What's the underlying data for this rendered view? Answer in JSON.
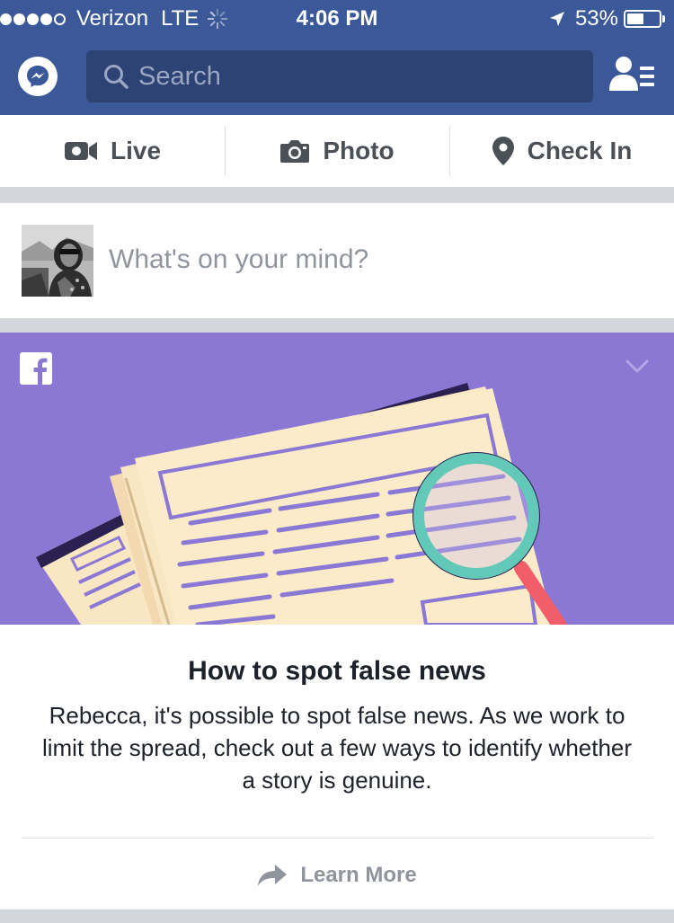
{
  "status_bar": {
    "carrier": "Verizon",
    "network": "LTE",
    "time": "4:06 PM",
    "battery_percent": "53%",
    "battery_level": 0.53,
    "signal_bars": 4,
    "signal_total": 5
  },
  "header": {
    "search_placeholder": "Search",
    "icons": [
      "messenger-icon",
      "search-icon",
      "friend-requests-icon"
    ]
  },
  "composer": {
    "actions": [
      {
        "label": "Live",
        "icon": "video-camera-icon"
      },
      {
        "label": "Photo",
        "icon": "camera-icon"
      },
      {
        "label": "Check In",
        "icon": "location-pin-icon"
      }
    ],
    "prompt": "What's on your mind?"
  },
  "card": {
    "title": "How to spot false news",
    "body": "Rebecca, it's possible to spot false news. As we work to limit the spread, check out a few ways to identify whether a story is genuine.",
    "cta": "Learn More",
    "hero_icons": [
      "facebook-logo-icon",
      "chevron-down-icon"
    ]
  },
  "colors": {
    "brand_blue": "#3b5998",
    "search_bg": "#2d4373",
    "hero_purple": "#8b77d4",
    "muted_text": "#90949c"
  }
}
